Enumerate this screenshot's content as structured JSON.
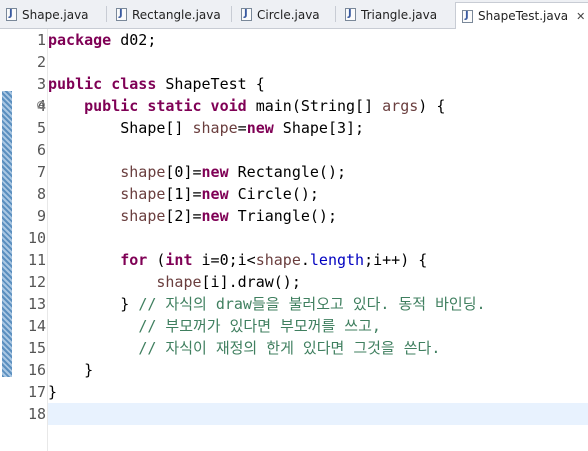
{
  "tabs": [
    {
      "label": "Shape.java",
      "active": false
    },
    {
      "label": "Rectangle.java",
      "active": false
    },
    {
      "label": "Circle.java",
      "active": false
    },
    {
      "label": "Triangle.java",
      "active": false
    },
    {
      "label": "ShapeTest.java",
      "active": true
    }
  ],
  "close_glyph": "✕",
  "line_numbers": [
    "1",
    "2",
    "3",
    "4",
    "5",
    "6",
    "7",
    "8",
    "9",
    "10",
    "11",
    "12",
    "13",
    "14",
    "15",
    "16",
    "17",
    "18"
  ],
  "fold_glyph": "⊖",
  "code": {
    "l1_kw": "package",
    "l1_rest": " d02;",
    "l3_kw": "public class",
    "l3_rest": " ShapeTest {",
    "l4_indent": "    ",
    "l4_kw": "public static void",
    "l4_mid": " main(String[] ",
    "l4_par": "args",
    "l4_end": ") {",
    "l5_indent": "        ",
    "l5_a": "Shape[] ",
    "l5_var": "shape",
    "l5_eq": "=",
    "l5_kw": "new",
    "l5_end": " Shape[3];",
    "l7_indent": "        ",
    "l7_var": "shape",
    "l7_idx": "[0]=",
    "l7_kw": "new",
    "l7_end": " Rectangle();",
    "l8_indent": "        ",
    "l8_var": "shape",
    "l8_idx": "[1]=",
    "l8_kw": "new",
    "l8_end": " Circle();",
    "l9_indent": "        ",
    "l9_var": "shape",
    "l9_idx": "[2]=",
    "l9_kw": "new",
    "l9_end": " Triangle();",
    "l11_indent": "        ",
    "l11_kw1": "for",
    "l11_a": " (",
    "l11_kw2": "int",
    "l11_b": " i=0;i<",
    "l11_var": "shape",
    "l11_dot": ".",
    "l11_fld": "length",
    "l11_end": ";i++) {",
    "l12_indent": "            ",
    "l12_var": "shape",
    "l12_end": "[i].draw();",
    "l13_indent": "        ",
    "l13_brace": "} ",
    "l13_cm": "// 자식의 draw들을 불러오고 있다. 동적 바인딩.",
    "l14_indent": "          ",
    "l14_cm": "// 부모꺼가 있다면 부모꺼를 쓰고,",
    "l15_indent": "          ",
    "l15_cm": "// 자식이 재정의 한게 있다면 그것을 쓴다.",
    "l16_indent": "    ",
    "l16_brace": "}",
    "l17_brace": "}"
  },
  "colors": {
    "keyword": "#7f0055",
    "field": "#0000c0",
    "parameter": "#6a3e3e",
    "comment": "#3f7f5f",
    "current_line": "#e8f2fe"
  }
}
